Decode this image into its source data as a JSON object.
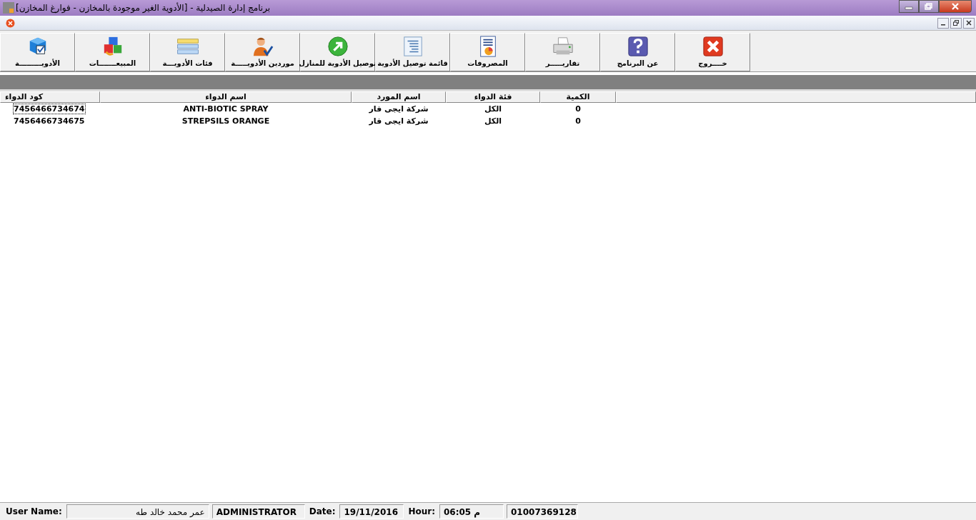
{
  "window": {
    "title": "[برنامج إدارة الصيدلية - [الأدوية الغير موجودة بالمخازن - فوارغ المخازن"
  },
  "toolbar": [
    {
      "label": "خــــروج",
      "kind": "exit"
    },
    {
      "label": "عن البرنامج",
      "kind": "help"
    },
    {
      "label": "تقاريـــــر",
      "kind": "printer"
    },
    {
      "label": "المصروفات",
      "kind": "doc"
    },
    {
      "label": "قائمة توصيل الأدوية",
      "kind": "list"
    },
    {
      "label": "توصيل الأدوية للمنازل",
      "kind": "arrow"
    },
    {
      "label": "موردين الأدويـــــة",
      "kind": "person"
    },
    {
      "label": "فئات الأدويـــة",
      "kind": "bars"
    },
    {
      "label": "المبيعـــــــات",
      "kind": "cubes"
    },
    {
      "label": "الأدويـــــــــة",
      "kind": "cube"
    }
  ],
  "table": {
    "columns": [
      "الكمية",
      "فئة الدواء",
      "اسم المورد",
      "اسم الدواء",
      "كود الدواء"
    ],
    "rows": [
      {
        "selected": true,
        "cells": [
          "0",
          "الكل",
          "شركة ايجى فار",
          "ANTI-BIOTIC SPRAY",
          "7456466734674"
        ]
      },
      {
        "selected": false,
        "cells": [
          "0",
          "الكل",
          "شركة ايجى فار",
          "STREPSILS ORANGE",
          "7456466734675"
        ]
      }
    ]
  },
  "status_bar": {
    "user_label": "User Name:",
    "user": "عمر محمد خالد طه",
    "role": "ADMINISTRATOR",
    "date_label": "Date:",
    "date": "19/11/2016",
    "hour_label": "Hour:",
    "hour": "06:05 م",
    "phone": "01007369128"
  }
}
